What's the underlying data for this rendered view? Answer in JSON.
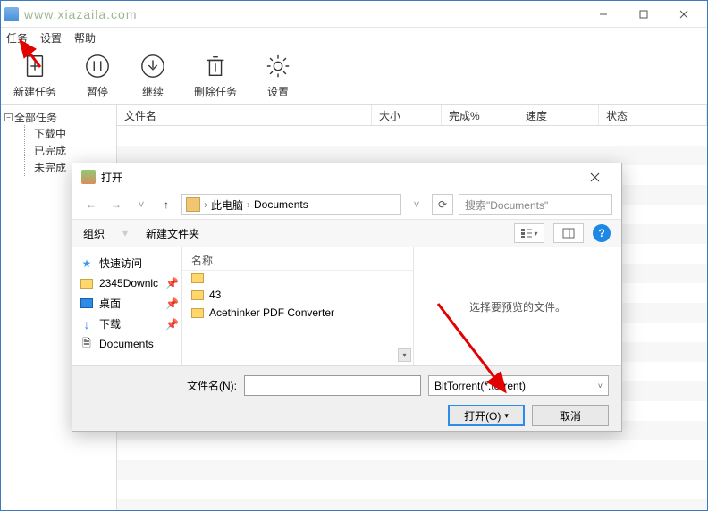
{
  "watermark": "www.xiazaila.com",
  "menu": {
    "task": "任务",
    "settings": "设置",
    "help": "帮助"
  },
  "toolbar": {
    "new_task": "新建任务",
    "pause": "暂停",
    "resume": "继续",
    "delete": "删除任务",
    "settings": "设置"
  },
  "tree": {
    "root": "全部任务",
    "downloading": "下载中",
    "completed": "已完成",
    "incomplete": "未完成"
  },
  "grid": {
    "name": "文件名",
    "size": "大小",
    "done": "完成%",
    "speed": "速度",
    "status": "状态"
  },
  "dialog": {
    "title": "打开",
    "breadcrumb": {
      "pc": "此电脑",
      "docs": "Documents"
    },
    "search_placeholder": "搜索\"Documents\"",
    "organize": "组织",
    "new_folder": "新建文件夹",
    "places": {
      "quick": "快速访问",
      "dl2345": "2345Downlc",
      "desktop": "桌面",
      "downloads": "下载",
      "documents": "Documents"
    },
    "filelist_header": "名称",
    "files": {
      "f1": "",
      "f2": "43",
      "f3": "Acethinker PDF Converter"
    },
    "preview_text": "选择要预览的文件。",
    "filename_label": "文件名(N):",
    "filename_value": "",
    "filetype": "BitTorrent(*.torrent)",
    "open_btn": "打开(O)",
    "cancel_btn": "取消"
  }
}
